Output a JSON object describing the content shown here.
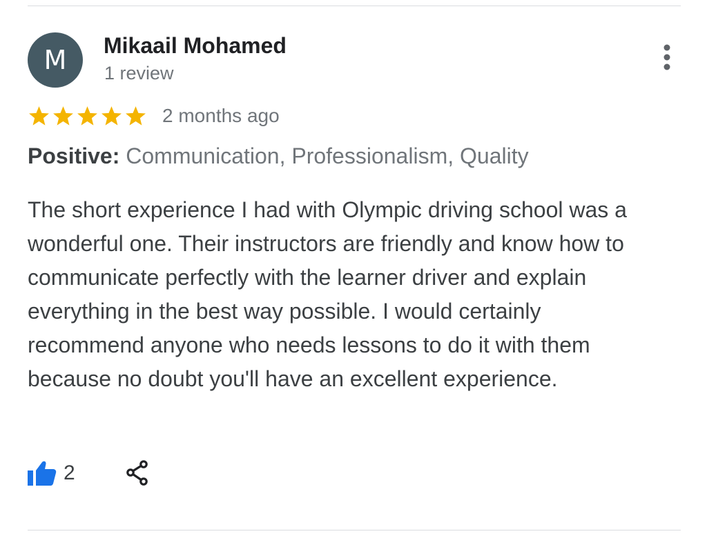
{
  "reviewer": {
    "initial": "M",
    "name": "Mikaail Mohamed",
    "review_count": "1 review",
    "avatar_color": "#455a64"
  },
  "rating": {
    "stars": 5,
    "max_stars": 5,
    "star_color": "#f4b400",
    "date": "2 months ago"
  },
  "positive": {
    "label": "Positive:",
    "values": "Communication, Professionalism, Quality"
  },
  "review": {
    "text": "The short experience I had with Olympic driving school was a wonderful one. Their instructors are friendly and know how to communicate perfectly with the learner driver and explain everything in the best way possible. I would certainly recommend anyone who needs lessons to do it with them because no doubt you'll have an excellent experience."
  },
  "actions": {
    "like_icon": "thumbs-up-icon",
    "like_count": "2",
    "like_color": "#1a73e8",
    "share_icon": "share-icon",
    "more_icon": "more-vertical-icon"
  }
}
